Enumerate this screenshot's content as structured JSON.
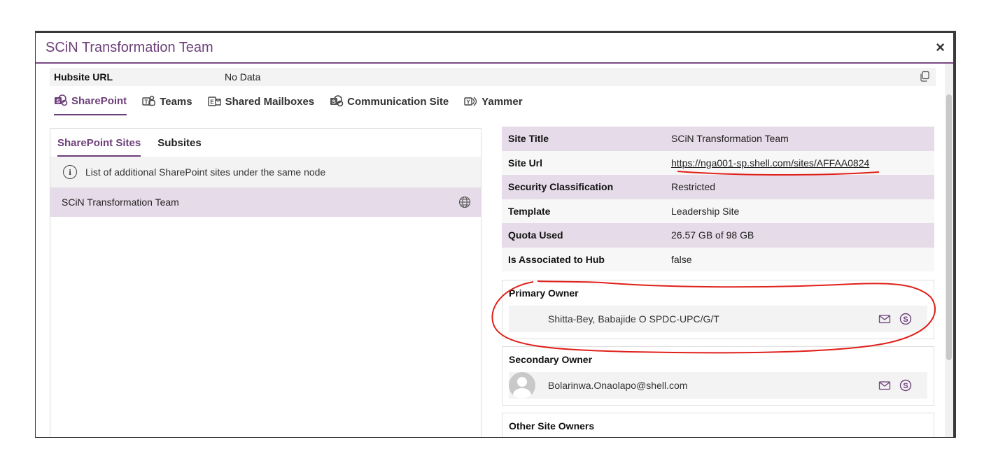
{
  "dialog": {
    "title": "SCiN Transformation Team",
    "close_symbol": "×"
  },
  "hub": {
    "label": "Hubsite URL",
    "value": "No Data"
  },
  "tabs": [
    {
      "label": "SharePoint",
      "icon": "sharepoint-icon",
      "active": true
    },
    {
      "label": "Teams",
      "icon": "teams-icon",
      "active": false
    },
    {
      "label": "Shared Mailboxes",
      "icon": "mailbox-icon",
      "active": false
    },
    {
      "label": "Communication Site",
      "icon": "sharepoint-icon",
      "active": false
    },
    {
      "label": "Yammer",
      "icon": "yammer-icon",
      "active": false
    }
  ],
  "left": {
    "subtabs": [
      {
        "label": "SharePoint Sites",
        "active": true
      },
      {
        "label": "Subsites",
        "active": false
      }
    ],
    "info": "List of additional SharePoint sites under the same node",
    "sites": [
      {
        "name": "SCiN Transformation Team"
      }
    ]
  },
  "properties": [
    {
      "label": "Site Title",
      "value": "SCiN Transformation Team"
    },
    {
      "label": "Site Url",
      "value": "https://nga001-sp.shell.com/sites/AFFAA0824"
    },
    {
      "label": "Security Classification",
      "value": "Restricted"
    },
    {
      "label": "Template",
      "value": "Leadership Site"
    },
    {
      "label": "Quota Used",
      "value": "26.57 GB of 98 GB"
    },
    {
      "label": "Is Associated to Hub",
      "value": "false"
    }
  ],
  "owners": {
    "primary": {
      "title": "Primary Owner",
      "name": "Shitta-Bey, Babajide O SPDC-UPC/G/T"
    },
    "secondary": {
      "title": "Secondary Owner",
      "name": "Bolarinwa.Onaolapo@shell.com"
    },
    "other": {
      "title": "Other Site Owners"
    }
  },
  "colors": {
    "accent": "#6d3f7a",
    "row_shade": "#e6dbe8",
    "annotation": "#e0201b"
  }
}
